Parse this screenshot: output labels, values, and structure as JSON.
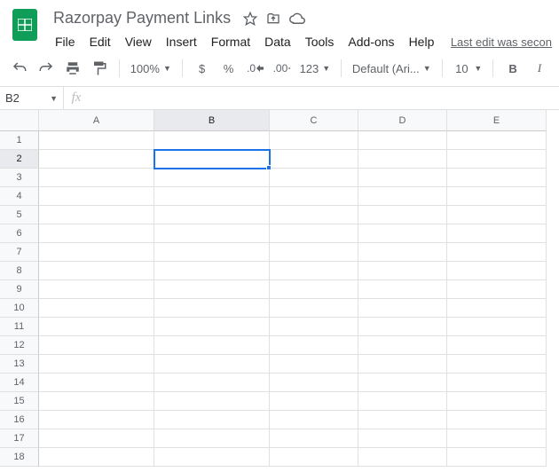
{
  "doc": {
    "title": "Razorpay Payment Links"
  },
  "menus": [
    "File",
    "Edit",
    "View",
    "Insert",
    "Format",
    "Data",
    "Tools",
    "Add-ons",
    "Help"
  ],
  "last_edit": "Last edit was secon",
  "toolbar": {
    "zoom": "100%",
    "currency": "$",
    "percent": "%",
    "dec_dec": ".0",
    "inc_dec": ".00",
    "more_formats": "123",
    "font": "Default (Ari...",
    "font_size": "10",
    "bold": "B",
    "italic": "I"
  },
  "namebox": "B2",
  "fx": "fx",
  "columns": [
    {
      "label": "A",
      "w": 130
    },
    {
      "label": "B",
      "w": 130
    },
    {
      "label": "C",
      "w": 100
    },
    {
      "label": "D",
      "w": 100
    },
    {
      "label": "E",
      "w": 112
    }
  ],
  "rows": [
    "1",
    "2",
    "3",
    "4",
    "5",
    "6",
    "7",
    "8",
    "9",
    "10",
    "11",
    "12",
    "13",
    "14",
    "15",
    "16",
    "17",
    "18"
  ],
  "selected": {
    "col": "B",
    "row": "2"
  }
}
